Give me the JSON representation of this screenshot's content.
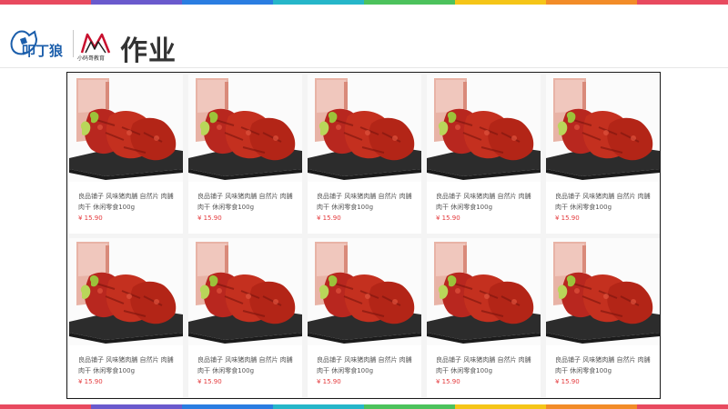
{
  "header": {
    "title": "作业",
    "logo1_text": "叩丁狼",
    "logo2_text": "小码哥教育"
  },
  "colors": {
    "rainbow": [
      "#e84a5f",
      "#6a5acd",
      "#2a7de1",
      "#26b6c9",
      "#4cc25c",
      "#f5c518",
      "#f28c28",
      "#e84a5f"
    ],
    "price": "#e4393c",
    "logo_blue": "#1b5eab",
    "logo_red": "#c8102e"
  },
  "products": [
    {
      "title": "良品铺子 风味猪肉脯 自然片 肉脯肉干 休闲零食100g",
      "price": "¥ 15.90",
      "image": "pork-jerky-image"
    },
    {
      "title": "良品铺子 风味猪肉脯 自然片 肉脯肉干 休闲零食100g",
      "price": "¥ 15.90",
      "image": "pork-jerky-image"
    },
    {
      "title": "良品铺子 风味猪肉脯 自然片 肉脯肉干 休闲零食100g",
      "price": "¥ 15.90",
      "image": "pork-jerky-image"
    },
    {
      "title": "良品铺子 风味猪肉脯 自然片 肉脯肉干 休闲零食100g",
      "price": "¥ 15.90",
      "image": "pork-jerky-image"
    },
    {
      "title": "良品铺子 风味猪肉脯 自然片 肉脯肉干 休闲零食100g",
      "price": "¥ 15.90",
      "image": "pork-jerky-image"
    },
    {
      "title": "良品铺子 风味猪肉脯 自然片 肉脯肉干 休闲零食100g",
      "price": "¥ 15.90",
      "image": "pork-jerky-image"
    },
    {
      "title": "良品铺子 风味猪肉脯 自然片 肉脯肉干 休闲零食100g",
      "price": "¥ 15.90",
      "image": "pork-jerky-image"
    },
    {
      "title": "良品铺子 风味猪肉脯 自然片 肉脯肉干 休闲零食100g",
      "price": "¥ 15.90",
      "image": "pork-jerky-image"
    },
    {
      "title": "良品铺子 风味猪肉脯 自然片 肉脯肉干 休闲零食100g",
      "price": "¥ 15.90",
      "image": "pork-jerky-image"
    },
    {
      "title": "良品铺子 风味猪肉脯 自然片 肉脯肉干 休闲零食100g",
      "price": "¥ 15.90",
      "image": "pork-jerky-image"
    }
  ]
}
